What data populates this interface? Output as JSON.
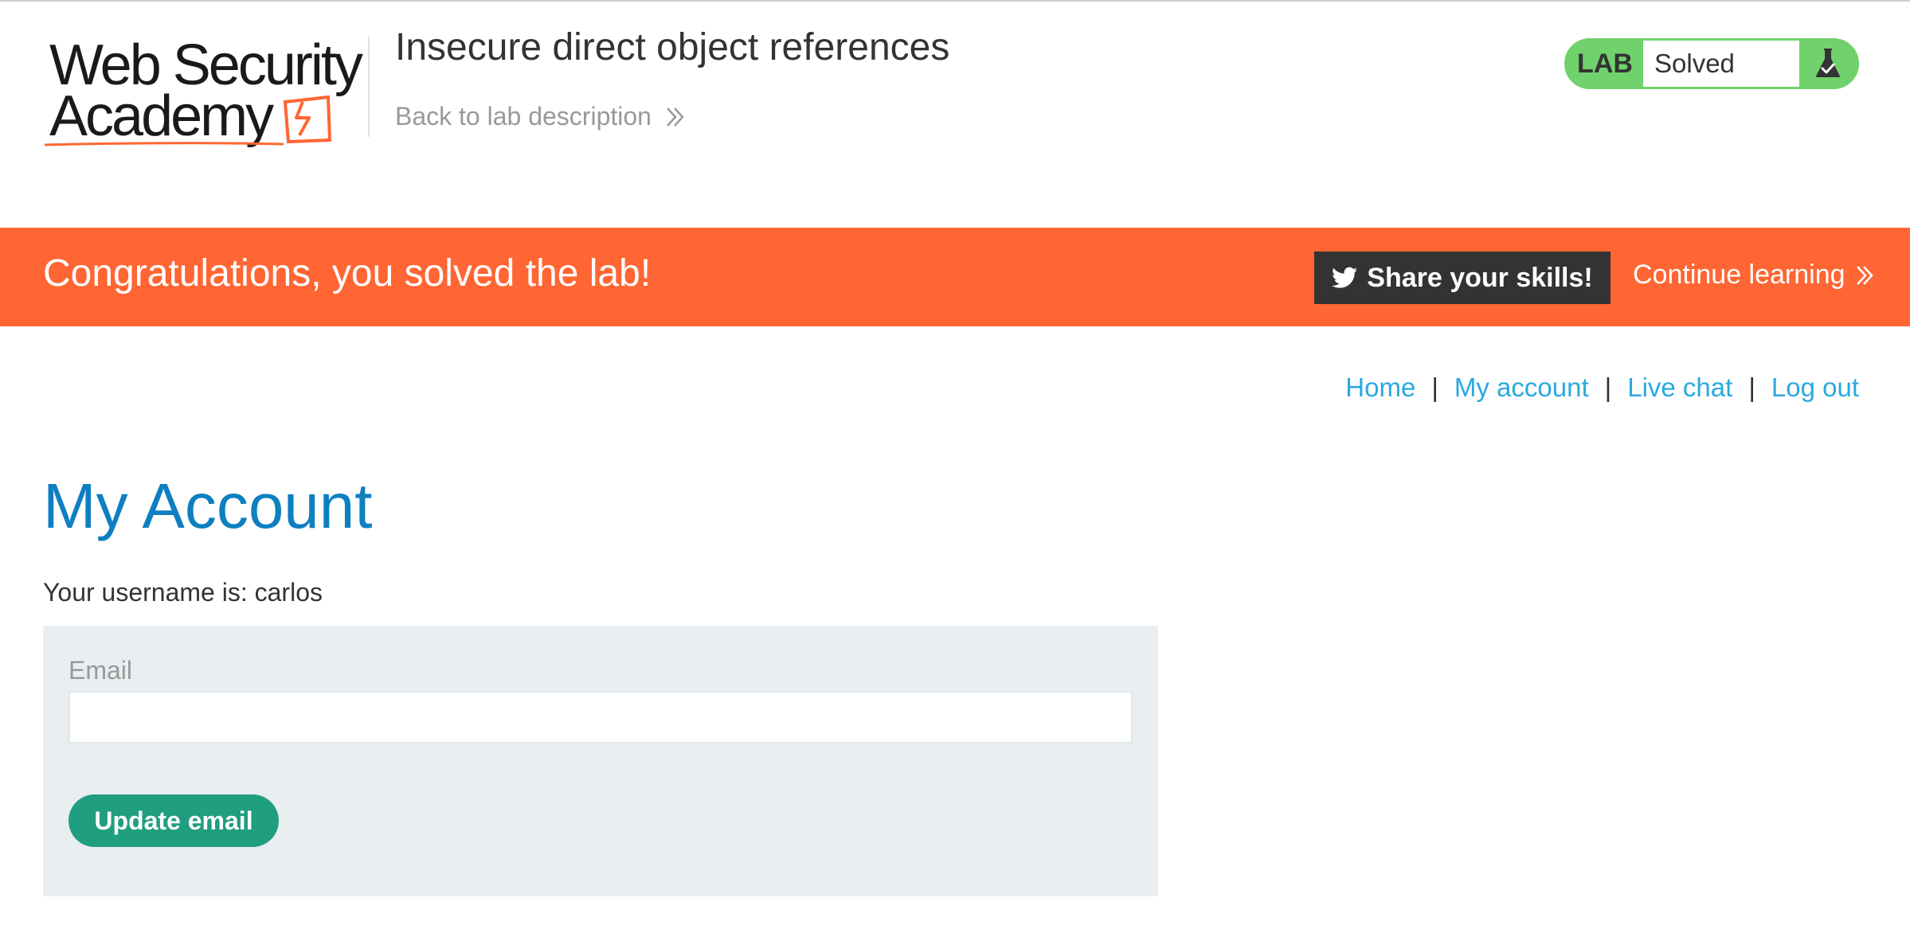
{
  "header": {
    "logo": {
      "line1": "Web Security",
      "line2": "Academy"
    },
    "lab_title": "Insecure direct object references",
    "back_link": "Back to lab description",
    "lab_status": {
      "tag": "LAB",
      "state": "Solved",
      "icon": "flask-check-icon"
    }
  },
  "banner": {
    "message": "Congratulations, you solved the lab!",
    "share_label": "Share your skills!",
    "share_icon": "twitter-bird-icon",
    "continue_label": "Continue learning"
  },
  "nav": {
    "items": [
      "Home",
      "My account",
      "Live chat",
      "Log out"
    ],
    "separator": "|"
  },
  "main": {
    "title": "My Account",
    "username_line": "Your username is: carlos",
    "email_label": "Email",
    "email_value": "",
    "update_button": "Update email"
  },
  "colors": {
    "accent_orange": "#ff6633",
    "lab_green": "#70d16d",
    "title_blue": "#0e7fc1",
    "link_blue": "#29a9e0",
    "button_green": "#1f9e80",
    "panel_bg": "#e9eef1",
    "share_bg": "#333332"
  }
}
